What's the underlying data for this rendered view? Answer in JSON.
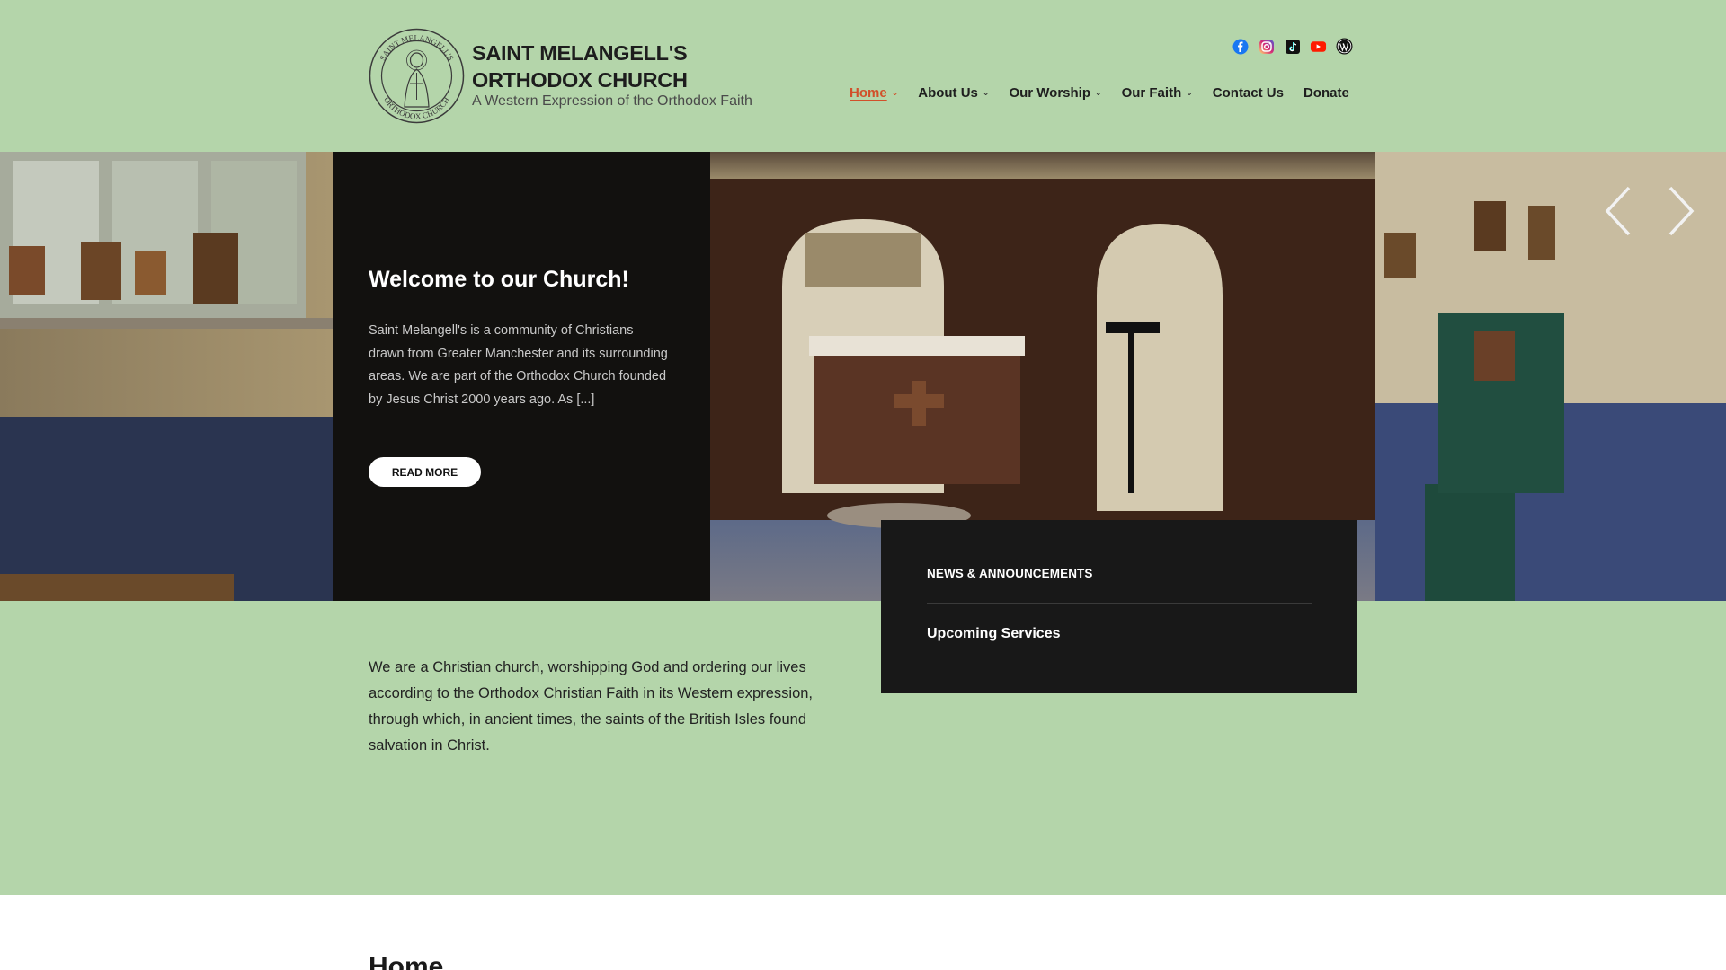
{
  "site": {
    "title_line1": "SAINT MELANGELL'S",
    "title_line2": "ORTHODOX CHURCH",
    "tagline": "A Western Expression of the Orthodox Faith",
    "logo_text_top": "SAINT MELANGELL'S",
    "logo_text_bottom": "ORTHODOX CHURCH"
  },
  "social": [
    "facebook-icon",
    "instagram-icon",
    "tiktok-icon",
    "youtube-icon",
    "wordpress-icon"
  ],
  "nav": [
    {
      "label": "Home",
      "dropdown": true,
      "active": true
    },
    {
      "label": "About Us",
      "dropdown": true,
      "active": false
    },
    {
      "label": "Our Worship",
      "dropdown": true,
      "active": false
    },
    {
      "label": "Our Faith",
      "dropdown": true,
      "active": false
    },
    {
      "label": "Contact Us",
      "dropdown": false,
      "active": false
    },
    {
      "label": "Donate",
      "dropdown": false,
      "active": false
    }
  ],
  "hero": {
    "title": "Welcome to our Church!",
    "text": "Saint Melangell's is a community of Christians drawn from Greater Manchester and its surrounding areas. We are part of the Orthodox Church founded by Jesus Christ 2000 years ago.  As [...]",
    "button": "READ MORE"
  },
  "news": {
    "heading": "NEWS & ANNOUNCEMENTS",
    "item": "Upcoming Services"
  },
  "intro": "We are a Christian church, worshipping God and ordering our lives according to the Orthodox Christian Faith in its Western expression, through which, in ancient times, the saints of the British Isles found salvation in Christ.",
  "page": {
    "title": "Home"
  },
  "colors": {
    "background": "#b4d5aa",
    "accent": "#d1502a",
    "panel": "#181818"
  }
}
